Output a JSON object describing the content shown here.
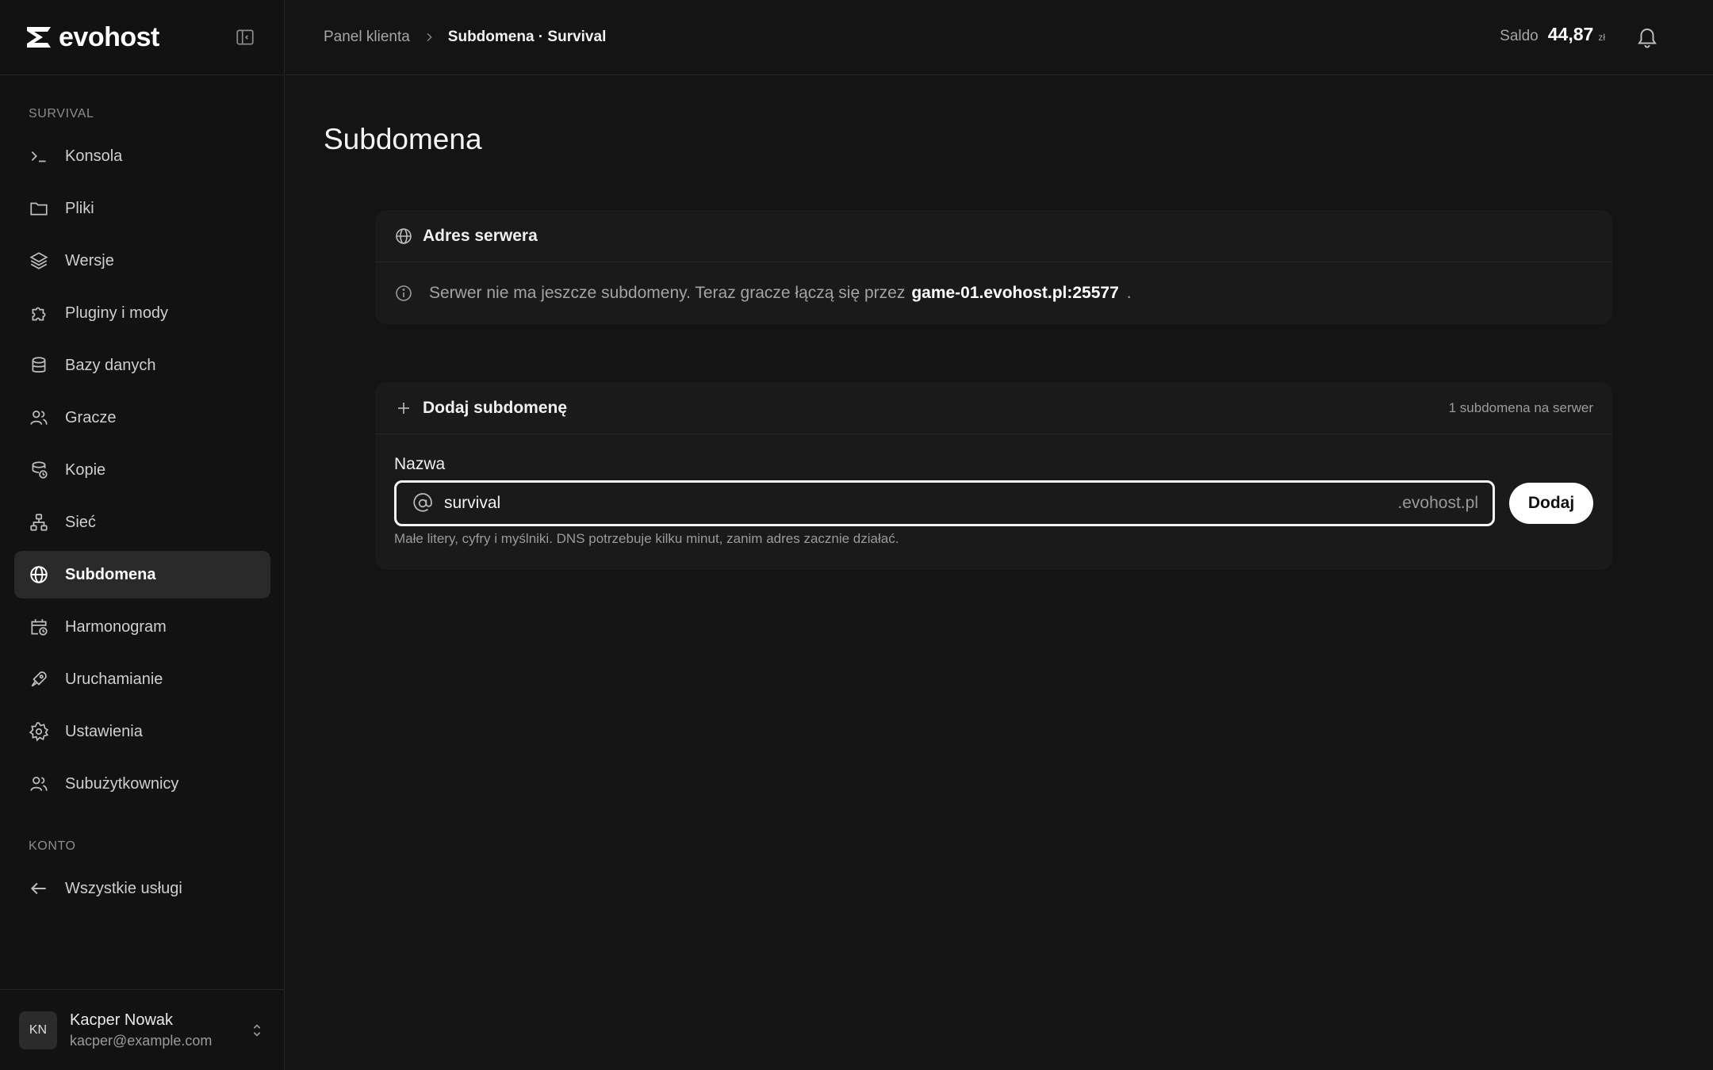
{
  "brand": {
    "name": "evohost"
  },
  "sidebar": {
    "section_server": "SURVIVAL",
    "items": [
      {
        "label": "Konsola",
        "icon": "terminal-icon"
      },
      {
        "label": "Pliki",
        "icon": "folder-icon"
      },
      {
        "label": "Wersje",
        "icon": "layers-icon"
      },
      {
        "label": "Pluginy i mody",
        "icon": "puzzle-icon"
      },
      {
        "label": "Bazy danych",
        "icon": "database-icon"
      },
      {
        "label": "Gracze",
        "icon": "users-icon"
      },
      {
        "label": "Kopie",
        "icon": "backup-icon"
      },
      {
        "label": "Sieć",
        "icon": "network-icon"
      },
      {
        "label": "Subdomena",
        "icon": "globe-icon",
        "active": true
      },
      {
        "label": "Harmonogram",
        "icon": "calendar-clock-icon"
      },
      {
        "label": "Uruchamianie",
        "icon": "rocket-icon"
      },
      {
        "label": "Ustawienia",
        "icon": "gear-icon"
      },
      {
        "label": "Subużytkownicy",
        "icon": "users-icon"
      }
    ],
    "section_account": "KONTO",
    "account_items": [
      {
        "label": "Wszystkie usługi",
        "icon": "arrow-left-icon"
      }
    ],
    "user": {
      "initials": "KN",
      "name": "Kacper Nowak",
      "email": "kacper@example.com"
    }
  },
  "topbar": {
    "breadcrumb_root": "Panel klienta",
    "breadcrumb_current": "Subdomena · Survival",
    "balance_label": "Saldo",
    "balance_value": "44,87",
    "balance_unit": "zł"
  },
  "page": {
    "title": "Subdomena"
  },
  "address_card": {
    "title": "Adres serwera",
    "info_text": "Serwer nie ma jeszcze subdomeny. Teraz gracze łączą się przez",
    "address": "game-01.evohost.pl:25577",
    "trailing": "."
  },
  "add_card": {
    "title": "Dodaj subdomenę",
    "limit": "1 subdomena na serwer",
    "field_label": "Nazwa",
    "input_value": "survival",
    "suffix": ".evohost.pl",
    "button": "Dodaj",
    "hint": "Małe litery, cyfry i myślniki. DNS potrzebuje kilku minut, zanim adres zacznie działać."
  },
  "colors": {
    "background": "#141414",
    "card": "#1b1a1b",
    "accent": "#ffffff"
  }
}
